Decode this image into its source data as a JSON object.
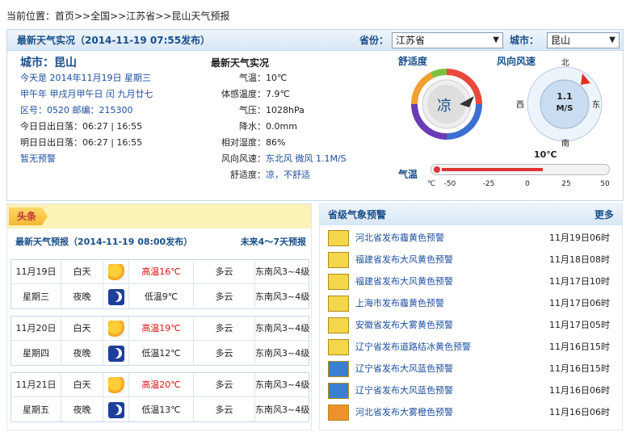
{
  "breadcrumb": "当前位置：首页>>全国>>江苏省>>昆山天气预报",
  "topbar": {
    "title": "最新天气实况（2014-11-19  07:55发布）",
    "province_label": "省份：",
    "province_value": "江苏省",
    "city_label": "城市：",
    "city_value": "昆山"
  },
  "city": {
    "title": "城市：昆山",
    "today": "今天是 2014年11月19日 星期三",
    "lunar": "甲午年 甲戌月甲午日 闰 九月廿七",
    "code": "区号：0520  邮编：215300",
    "today_sun": "今日日出日落：06:27 | 16:55",
    "tomorrow_sun": "明日日出日落：06:27 | 16:55",
    "warning": "暂无预警"
  },
  "live": {
    "title": "最新天气实况",
    "rows": [
      {
        "label": "气温：",
        "value": "10℃",
        "blue": false
      },
      {
        "label": "体感温度：",
        "value": "7.9℃",
        "blue": false
      },
      {
        "label": "气压：",
        "value": "1028hPa",
        "blue": false
      },
      {
        "label": "降水：",
        "value": "0.0mm",
        "blue": false
      },
      {
        "label": "相对湿度：",
        "value": "86%",
        "blue": false
      },
      {
        "label": "风向风速：",
        "value": "东北风 微风 1.1M/S",
        "blue": true
      },
      {
        "label": "舒适度：",
        "value": "凉，不舒适",
        "blue": true
      }
    ]
  },
  "comfort": {
    "title": "舒适度",
    "value": "凉"
  },
  "wind": {
    "title": "风向风速",
    "speed": "1.1",
    "unit": "M/S",
    "n": "北",
    "s": "南",
    "e": "东",
    "w": "西"
  },
  "temp_gauge": {
    "title": "气温",
    "value_label": "10℃",
    "value": 10,
    "unit": "℃",
    "ticks": [
      "-50",
      "-25",
      "0",
      "25",
      "50"
    ]
  },
  "headline": {
    "tag": "头条"
  },
  "forecast": {
    "title": "最新天气预报（2014-11-19  08:00发布）",
    "more": "未来4～7天预报",
    "days": [
      {
        "date": "11月19日",
        "week": "星期三",
        "day": "白天",
        "night": "夜晚",
        "high": "高温16℃",
        "low": "低温9℃",
        "sky_day": "多云",
        "sky_night": "多云",
        "wind_day": "东南风3~4级",
        "wind_night": "东南风3~4级"
      },
      {
        "date": "11月20日",
        "week": "星期四",
        "day": "白天",
        "night": "夜晚",
        "high": "高温19℃",
        "low": "低温12℃",
        "sky_day": "多云",
        "sky_night": "多云",
        "wind_day": "东南风3~4级",
        "wind_night": "东南风3~4级"
      },
      {
        "date": "11月21日",
        "week": "星期五",
        "day": "白天",
        "night": "夜晚",
        "high": "高温20℃",
        "low": "低温13℃",
        "sky_day": "多云",
        "sky_night": "多云",
        "wind_day": "东南风3~4级",
        "wind_night": "东南风3~4级"
      }
    ]
  },
  "warnings": {
    "title": "省级气象预警",
    "more": "更多",
    "items": [
      {
        "text": "河北省发布霾黄色预警",
        "date": "11月19日06时",
        "color": "#f3d64a"
      },
      {
        "text": "福建省发布大风黄色预警",
        "date": "11月18日08时",
        "color": "#f3d64a"
      },
      {
        "text": "福建省发布大风黄色预警",
        "date": "11月17日10时",
        "color": "#f3d64a"
      },
      {
        "text": "上海市发布霾黄色预警",
        "date": "11月17日06时",
        "color": "#f3d64a"
      },
      {
        "text": "安徽省发布大雾黄色预警",
        "date": "11月17日05时",
        "color": "#f3d64a"
      },
      {
        "text": "辽宁省发布道路结冰黄色预警",
        "date": "11月16日15时",
        "color": "#f3d64a"
      },
      {
        "text": "辽宁省发布大风蓝色预警",
        "date": "11月16日15时",
        "color": "#3b7fd0"
      },
      {
        "text": "辽宁省发布大风蓝色预警",
        "date": "11月16日06时",
        "color": "#3b7fd0"
      },
      {
        "text": "河北省发布大雾橙色预警",
        "date": "11月16日06时",
        "color": "#f0902a"
      }
    ]
  }
}
